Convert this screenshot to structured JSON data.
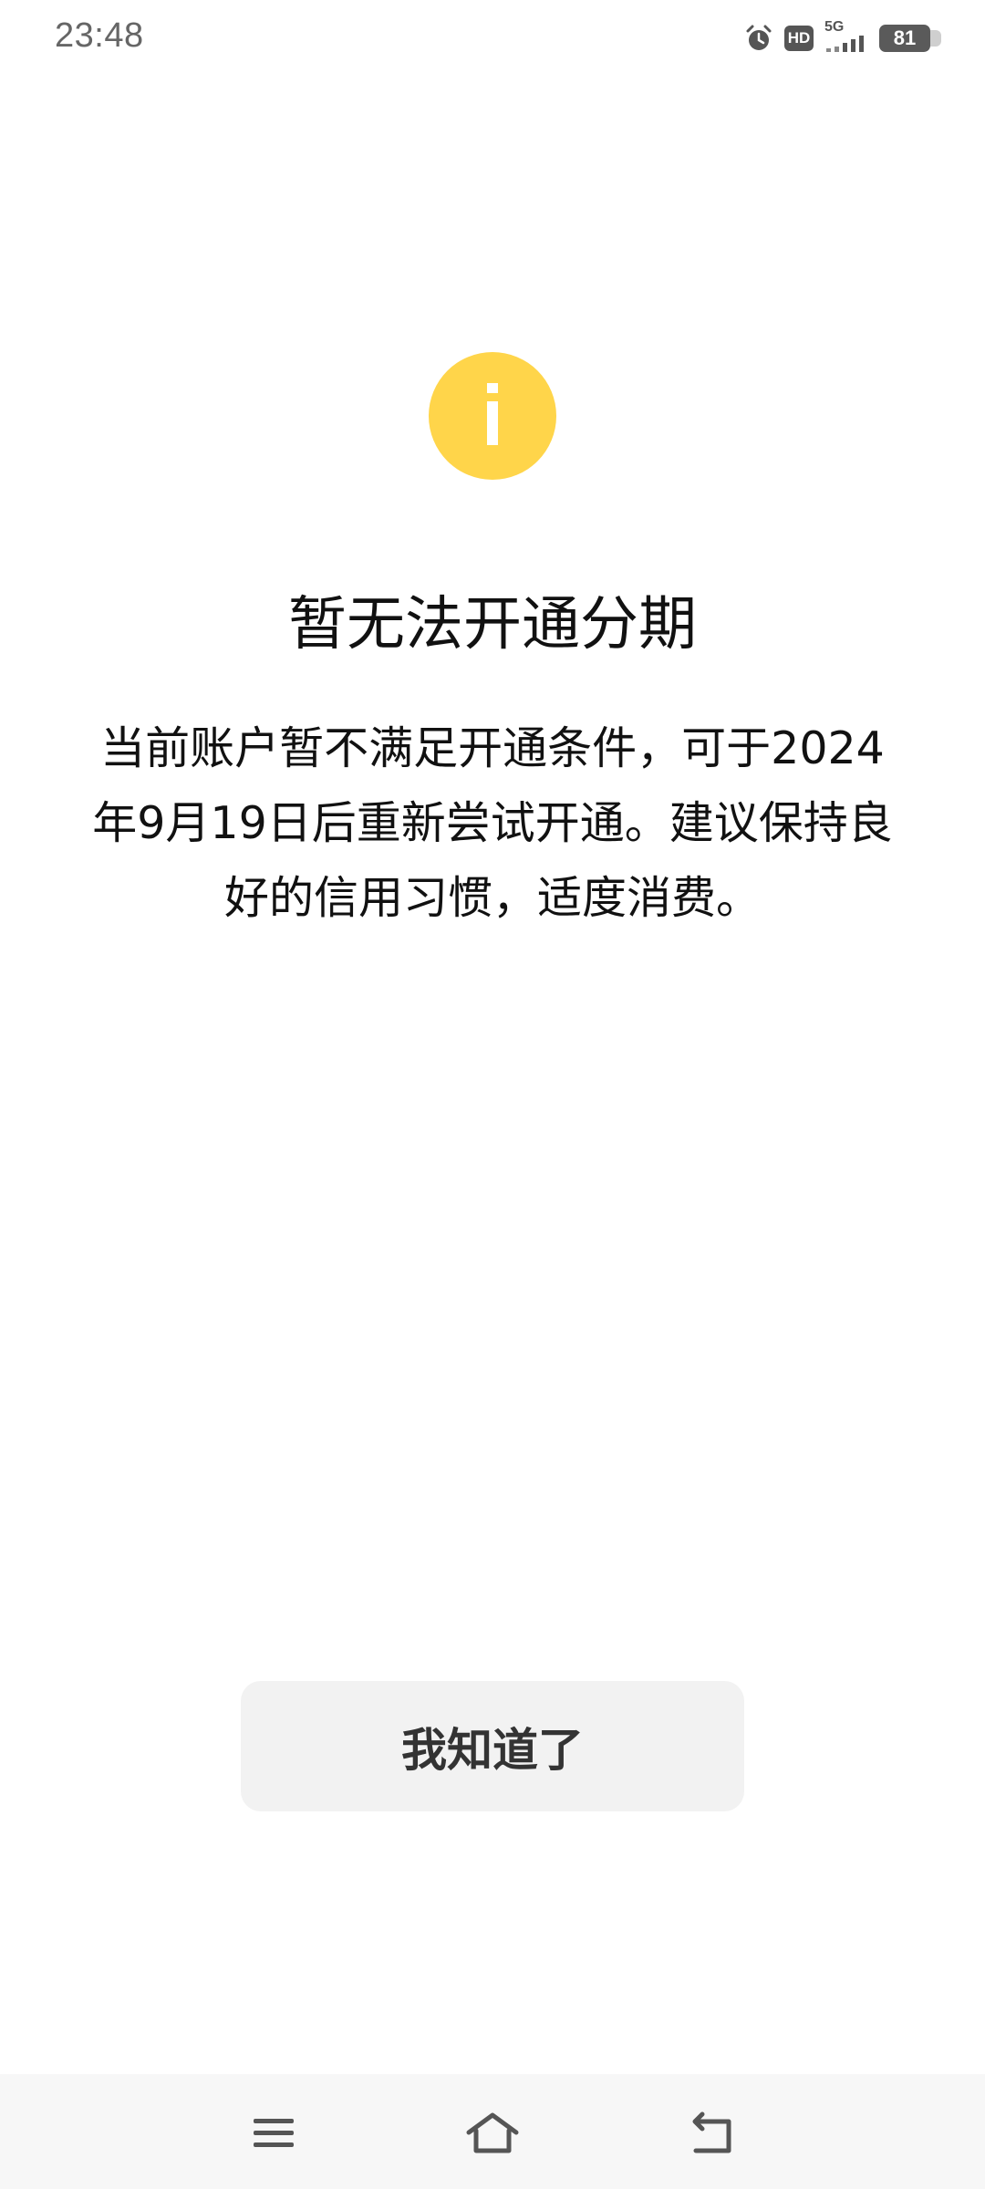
{
  "status_bar": {
    "time": "23:48",
    "network": "5G",
    "hd_label": "HD",
    "battery_level": "81"
  },
  "dialog": {
    "icon": "info-icon",
    "icon_color": "#ffd54a",
    "title": "暂无法开通分期",
    "message": "当前账户暂不满足开通条件，可于2024年9月19日后重新尝试开通。建议保持良好的信用习惯，适度消费。",
    "button_label": "我知道了"
  },
  "nav_bar": {
    "items": [
      "menu-icon",
      "home-icon",
      "back-icon"
    ]
  }
}
